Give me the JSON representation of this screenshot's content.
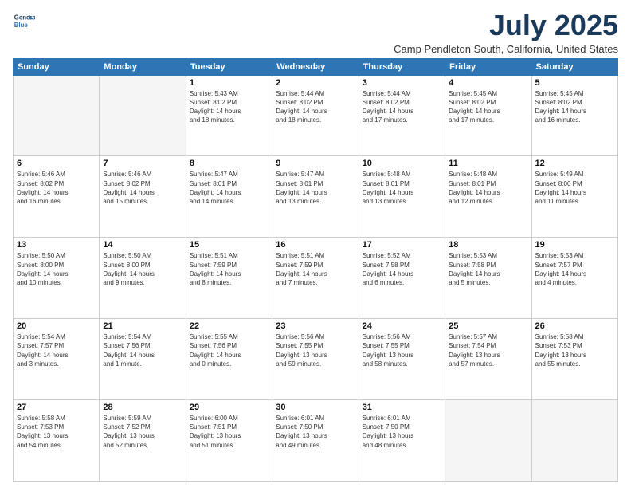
{
  "header": {
    "logo_line1": "General",
    "logo_line2": "Blue",
    "title": "July 2025",
    "subtitle": "Camp Pendleton South, California, United States"
  },
  "weekdays": [
    "Sunday",
    "Monday",
    "Tuesday",
    "Wednesday",
    "Thursday",
    "Friday",
    "Saturday"
  ],
  "weeks": [
    [
      {
        "day": "",
        "info": ""
      },
      {
        "day": "",
        "info": ""
      },
      {
        "day": "1",
        "info": "Sunrise: 5:43 AM\nSunset: 8:02 PM\nDaylight: 14 hours\nand 18 minutes."
      },
      {
        "day": "2",
        "info": "Sunrise: 5:44 AM\nSunset: 8:02 PM\nDaylight: 14 hours\nand 18 minutes."
      },
      {
        "day": "3",
        "info": "Sunrise: 5:44 AM\nSunset: 8:02 PM\nDaylight: 14 hours\nand 17 minutes."
      },
      {
        "day": "4",
        "info": "Sunrise: 5:45 AM\nSunset: 8:02 PM\nDaylight: 14 hours\nand 17 minutes."
      },
      {
        "day": "5",
        "info": "Sunrise: 5:45 AM\nSunset: 8:02 PM\nDaylight: 14 hours\nand 16 minutes."
      }
    ],
    [
      {
        "day": "6",
        "info": "Sunrise: 5:46 AM\nSunset: 8:02 PM\nDaylight: 14 hours\nand 16 minutes."
      },
      {
        "day": "7",
        "info": "Sunrise: 5:46 AM\nSunset: 8:02 PM\nDaylight: 14 hours\nand 15 minutes."
      },
      {
        "day": "8",
        "info": "Sunrise: 5:47 AM\nSunset: 8:01 PM\nDaylight: 14 hours\nand 14 minutes."
      },
      {
        "day": "9",
        "info": "Sunrise: 5:47 AM\nSunset: 8:01 PM\nDaylight: 14 hours\nand 13 minutes."
      },
      {
        "day": "10",
        "info": "Sunrise: 5:48 AM\nSunset: 8:01 PM\nDaylight: 14 hours\nand 13 minutes."
      },
      {
        "day": "11",
        "info": "Sunrise: 5:48 AM\nSunset: 8:01 PM\nDaylight: 14 hours\nand 12 minutes."
      },
      {
        "day": "12",
        "info": "Sunrise: 5:49 AM\nSunset: 8:00 PM\nDaylight: 14 hours\nand 11 minutes."
      }
    ],
    [
      {
        "day": "13",
        "info": "Sunrise: 5:50 AM\nSunset: 8:00 PM\nDaylight: 14 hours\nand 10 minutes."
      },
      {
        "day": "14",
        "info": "Sunrise: 5:50 AM\nSunset: 8:00 PM\nDaylight: 14 hours\nand 9 minutes."
      },
      {
        "day": "15",
        "info": "Sunrise: 5:51 AM\nSunset: 7:59 PM\nDaylight: 14 hours\nand 8 minutes."
      },
      {
        "day": "16",
        "info": "Sunrise: 5:51 AM\nSunset: 7:59 PM\nDaylight: 14 hours\nand 7 minutes."
      },
      {
        "day": "17",
        "info": "Sunrise: 5:52 AM\nSunset: 7:58 PM\nDaylight: 14 hours\nand 6 minutes."
      },
      {
        "day": "18",
        "info": "Sunrise: 5:53 AM\nSunset: 7:58 PM\nDaylight: 14 hours\nand 5 minutes."
      },
      {
        "day": "19",
        "info": "Sunrise: 5:53 AM\nSunset: 7:57 PM\nDaylight: 14 hours\nand 4 minutes."
      }
    ],
    [
      {
        "day": "20",
        "info": "Sunrise: 5:54 AM\nSunset: 7:57 PM\nDaylight: 14 hours\nand 3 minutes."
      },
      {
        "day": "21",
        "info": "Sunrise: 5:54 AM\nSunset: 7:56 PM\nDaylight: 14 hours\nand 1 minute."
      },
      {
        "day": "22",
        "info": "Sunrise: 5:55 AM\nSunset: 7:56 PM\nDaylight: 14 hours\nand 0 minutes."
      },
      {
        "day": "23",
        "info": "Sunrise: 5:56 AM\nSunset: 7:55 PM\nDaylight: 13 hours\nand 59 minutes."
      },
      {
        "day": "24",
        "info": "Sunrise: 5:56 AM\nSunset: 7:55 PM\nDaylight: 13 hours\nand 58 minutes."
      },
      {
        "day": "25",
        "info": "Sunrise: 5:57 AM\nSunset: 7:54 PM\nDaylight: 13 hours\nand 57 minutes."
      },
      {
        "day": "26",
        "info": "Sunrise: 5:58 AM\nSunset: 7:53 PM\nDaylight: 13 hours\nand 55 minutes."
      }
    ],
    [
      {
        "day": "27",
        "info": "Sunrise: 5:58 AM\nSunset: 7:53 PM\nDaylight: 13 hours\nand 54 minutes."
      },
      {
        "day": "28",
        "info": "Sunrise: 5:59 AM\nSunset: 7:52 PM\nDaylight: 13 hours\nand 52 minutes."
      },
      {
        "day": "29",
        "info": "Sunrise: 6:00 AM\nSunset: 7:51 PM\nDaylight: 13 hours\nand 51 minutes."
      },
      {
        "day": "30",
        "info": "Sunrise: 6:01 AM\nSunset: 7:50 PM\nDaylight: 13 hours\nand 49 minutes."
      },
      {
        "day": "31",
        "info": "Sunrise: 6:01 AM\nSunset: 7:50 PM\nDaylight: 13 hours\nand 48 minutes."
      },
      {
        "day": "",
        "info": ""
      },
      {
        "day": "",
        "info": ""
      }
    ]
  ]
}
